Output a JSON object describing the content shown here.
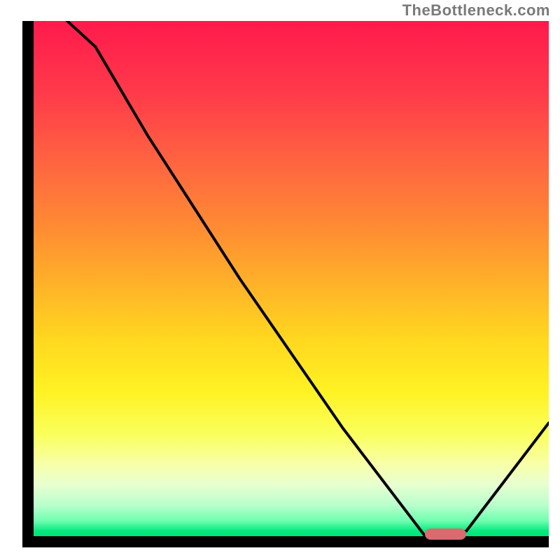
{
  "attribution": "TheBottleneck.com",
  "colors": {
    "gradient_top": "#ff1a4d",
    "gradient_mid": "#ffd81f",
    "gradient_bottom": "#00e472",
    "axis": "#000000",
    "curve": "#000000",
    "marker": "#d96b6f"
  },
  "chart_data": {
    "type": "line",
    "title": "",
    "xlabel": "",
    "ylabel": "",
    "xlim": [
      0,
      100
    ],
    "ylim": [
      0,
      100
    ],
    "grid": false,
    "x": [
      0,
      12,
      22,
      40,
      60,
      76,
      80,
      84,
      100
    ],
    "y": [
      106,
      95,
      78,
      50,
      21,
      0,
      0,
      1,
      22
    ],
    "marker": {
      "x_start": 76,
      "x_end": 84,
      "y": 0
    },
    "notes": "Black curve over vertical red→green gradient; minimum plateau marked by pink bar near x≈76–84."
  }
}
